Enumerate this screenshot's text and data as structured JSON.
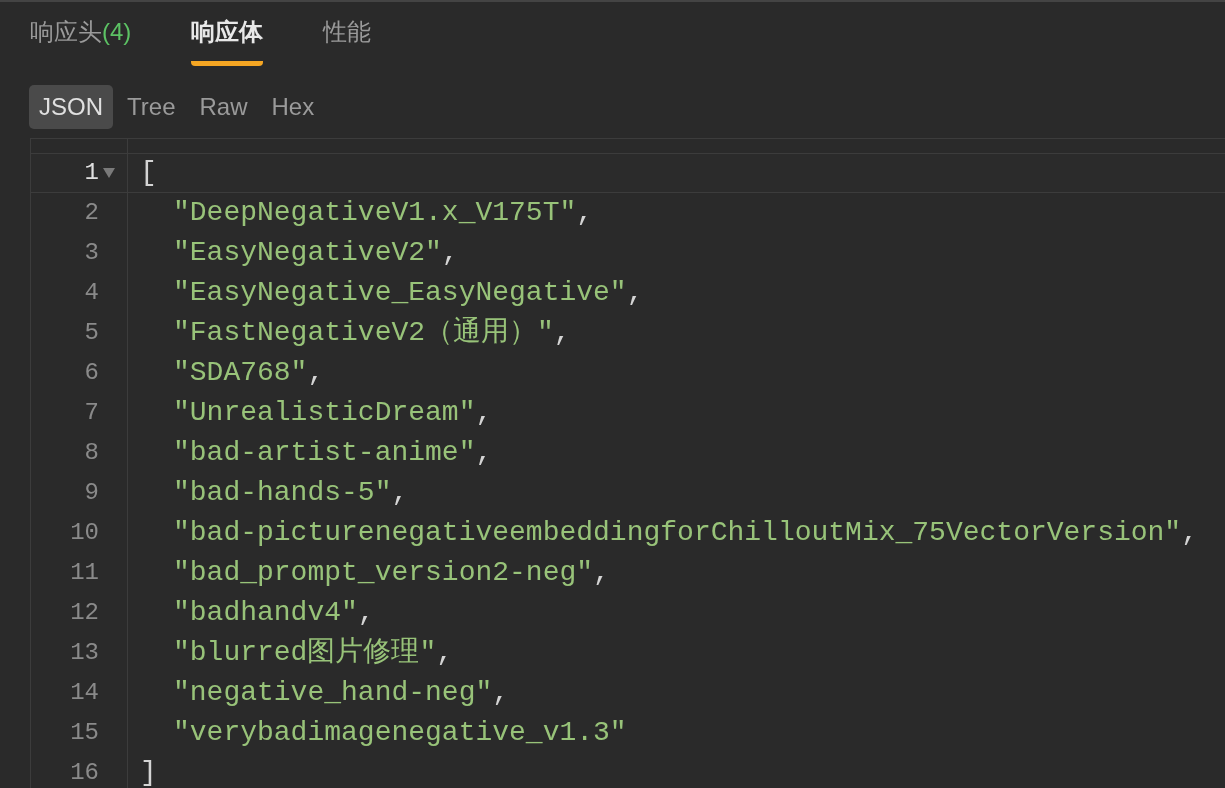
{
  "response_tabs": [
    {
      "label": "响应头",
      "count": "(4)",
      "selected": false
    },
    {
      "label": "响应体",
      "selected": true
    },
    {
      "label": "性能",
      "selected": false
    }
  ],
  "view_tabs": [
    {
      "label": "JSON",
      "selected": true
    },
    {
      "label": "Tree",
      "selected": false
    },
    {
      "label": "Raw",
      "selected": false
    },
    {
      "label": "Hex",
      "selected": false
    }
  ],
  "editor": {
    "lines": [
      {
        "number": "1",
        "kind": "bracket",
        "text": "[",
        "foldable": true,
        "active": true
      },
      {
        "number": "2",
        "kind": "string",
        "text": "\"DeepNegativeV1.x_V175T\"",
        "suffix": ","
      },
      {
        "number": "3",
        "kind": "string",
        "text": "\"EasyNegativeV2\"",
        "suffix": ","
      },
      {
        "number": "4",
        "kind": "string",
        "text": "\"EasyNegative_EasyNegative\"",
        "suffix": ","
      },
      {
        "number": "5",
        "kind": "string",
        "text": "\"FastNegativeV2（通用）\"",
        "suffix": ","
      },
      {
        "number": "6",
        "kind": "string",
        "text": "\"SDA768\"",
        "suffix": ","
      },
      {
        "number": "7",
        "kind": "string",
        "text": "\"UnrealisticDream\"",
        "suffix": ","
      },
      {
        "number": "8",
        "kind": "string",
        "text": "\"bad-artist-anime\"",
        "suffix": ","
      },
      {
        "number": "9",
        "kind": "string",
        "text": "\"bad-hands-5\"",
        "suffix": ","
      },
      {
        "number": "10",
        "kind": "string",
        "text": "\"bad-picturenegativeembeddingforChilloutMix_75VectorVersion\"",
        "suffix": ","
      },
      {
        "number": "11",
        "kind": "string",
        "text": "\"bad_prompt_version2-neg\"",
        "suffix": ","
      },
      {
        "number": "12",
        "kind": "string",
        "text": "\"badhandv4\"",
        "suffix": ","
      },
      {
        "number": "13",
        "kind": "string",
        "text": "\"blurred图片修理\"",
        "suffix": ","
      },
      {
        "number": "14",
        "kind": "string",
        "text": "\"negative_hand-neg\"",
        "suffix": ","
      },
      {
        "number": "15",
        "kind": "string",
        "text": "\"verybadimagenegative_v1.3\""
      },
      {
        "number": "16",
        "kind": "bracket",
        "text": "]",
        "active": false
      }
    ]
  }
}
